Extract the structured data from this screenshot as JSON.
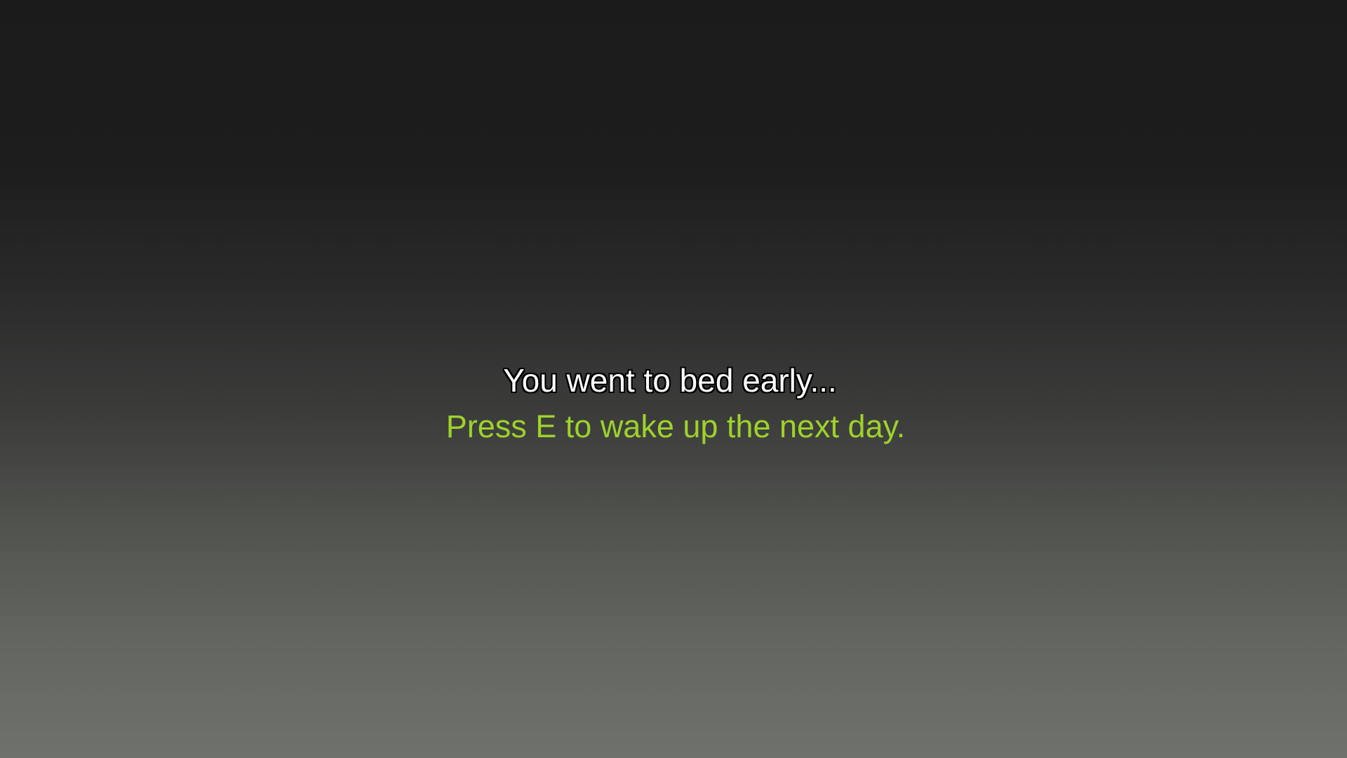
{
  "screen": {
    "message": "You went to bed early...",
    "prompt": "Press E to wake up the next day.",
    "colors": {
      "message_text": "#ffffff",
      "message_outline": "#000000",
      "prompt_text": "#9ed22a",
      "background_top": "#1b1b1b",
      "background_bottom": "#6f726c"
    }
  }
}
